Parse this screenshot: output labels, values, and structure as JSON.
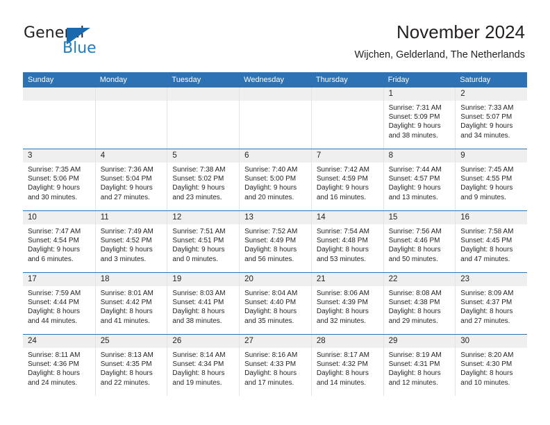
{
  "logo": {
    "word_general": "General",
    "word_blue": "Blue",
    "triangle_color": "#1b69ad",
    "blue_text_color": "#1f7dc1"
  },
  "header": {
    "title": "November 2024",
    "subtitle": "Wijchen, Gelderland, The Netherlands"
  },
  "theme": {
    "header_blue": "#2c72b4",
    "daynum_band": "#efefef",
    "grid_line": "#e3e3e3",
    "text": "#231f20"
  },
  "weekdays": [
    "Sunday",
    "Monday",
    "Tuesday",
    "Wednesday",
    "Thursday",
    "Friday",
    "Saturday"
  ],
  "weeks": [
    [
      {
        "day": "",
        "sunrise": "",
        "sunset": "",
        "daylight1": "",
        "daylight2": "",
        "empty": true
      },
      {
        "day": "",
        "sunrise": "",
        "sunset": "",
        "daylight1": "",
        "daylight2": "",
        "empty": true
      },
      {
        "day": "",
        "sunrise": "",
        "sunset": "",
        "daylight1": "",
        "daylight2": "",
        "empty": true
      },
      {
        "day": "",
        "sunrise": "",
        "sunset": "",
        "daylight1": "",
        "daylight2": "",
        "empty": true
      },
      {
        "day": "",
        "sunrise": "",
        "sunset": "",
        "daylight1": "",
        "daylight2": "",
        "empty": true
      },
      {
        "day": "1",
        "sunrise": "Sunrise: 7:31 AM",
        "sunset": "Sunset: 5:09 PM",
        "daylight1": "Daylight: 9 hours",
        "daylight2": "and 38 minutes.",
        "empty": false
      },
      {
        "day": "2",
        "sunrise": "Sunrise: 7:33 AM",
        "sunset": "Sunset: 5:07 PM",
        "daylight1": "Daylight: 9 hours",
        "daylight2": "and 34 minutes.",
        "empty": false
      }
    ],
    [
      {
        "day": "3",
        "sunrise": "Sunrise: 7:35 AM",
        "sunset": "Sunset: 5:06 PM",
        "daylight1": "Daylight: 9 hours",
        "daylight2": "and 30 minutes.",
        "empty": false
      },
      {
        "day": "4",
        "sunrise": "Sunrise: 7:36 AM",
        "sunset": "Sunset: 5:04 PM",
        "daylight1": "Daylight: 9 hours",
        "daylight2": "and 27 minutes.",
        "empty": false
      },
      {
        "day": "5",
        "sunrise": "Sunrise: 7:38 AM",
        "sunset": "Sunset: 5:02 PM",
        "daylight1": "Daylight: 9 hours",
        "daylight2": "and 23 minutes.",
        "empty": false
      },
      {
        "day": "6",
        "sunrise": "Sunrise: 7:40 AM",
        "sunset": "Sunset: 5:00 PM",
        "daylight1": "Daylight: 9 hours",
        "daylight2": "and 20 minutes.",
        "empty": false
      },
      {
        "day": "7",
        "sunrise": "Sunrise: 7:42 AM",
        "sunset": "Sunset: 4:59 PM",
        "daylight1": "Daylight: 9 hours",
        "daylight2": "and 16 minutes.",
        "empty": false
      },
      {
        "day": "8",
        "sunrise": "Sunrise: 7:44 AM",
        "sunset": "Sunset: 4:57 PM",
        "daylight1": "Daylight: 9 hours",
        "daylight2": "and 13 minutes.",
        "empty": false
      },
      {
        "day": "9",
        "sunrise": "Sunrise: 7:45 AM",
        "sunset": "Sunset: 4:55 PM",
        "daylight1": "Daylight: 9 hours",
        "daylight2": "and 9 minutes.",
        "empty": false
      }
    ],
    [
      {
        "day": "10",
        "sunrise": "Sunrise: 7:47 AM",
        "sunset": "Sunset: 4:54 PM",
        "daylight1": "Daylight: 9 hours",
        "daylight2": "and 6 minutes.",
        "empty": false
      },
      {
        "day": "11",
        "sunrise": "Sunrise: 7:49 AM",
        "sunset": "Sunset: 4:52 PM",
        "daylight1": "Daylight: 9 hours",
        "daylight2": "and 3 minutes.",
        "empty": false
      },
      {
        "day": "12",
        "sunrise": "Sunrise: 7:51 AM",
        "sunset": "Sunset: 4:51 PM",
        "daylight1": "Daylight: 9 hours",
        "daylight2": "and 0 minutes.",
        "empty": false
      },
      {
        "day": "13",
        "sunrise": "Sunrise: 7:52 AM",
        "sunset": "Sunset: 4:49 PM",
        "daylight1": "Daylight: 8 hours",
        "daylight2": "and 56 minutes.",
        "empty": false
      },
      {
        "day": "14",
        "sunrise": "Sunrise: 7:54 AM",
        "sunset": "Sunset: 4:48 PM",
        "daylight1": "Daylight: 8 hours",
        "daylight2": "and 53 minutes.",
        "empty": false
      },
      {
        "day": "15",
        "sunrise": "Sunrise: 7:56 AM",
        "sunset": "Sunset: 4:46 PM",
        "daylight1": "Daylight: 8 hours",
        "daylight2": "and 50 minutes.",
        "empty": false
      },
      {
        "day": "16",
        "sunrise": "Sunrise: 7:58 AM",
        "sunset": "Sunset: 4:45 PM",
        "daylight1": "Daylight: 8 hours",
        "daylight2": "and 47 minutes.",
        "empty": false
      }
    ],
    [
      {
        "day": "17",
        "sunrise": "Sunrise: 7:59 AM",
        "sunset": "Sunset: 4:44 PM",
        "daylight1": "Daylight: 8 hours",
        "daylight2": "and 44 minutes.",
        "empty": false
      },
      {
        "day": "18",
        "sunrise": "Sunrise: 8:01 AM",
        "sunset": "Sunset: 4:42 PM",
        "daylight1": "Daylight: 8 hours",
        "daylight2": "and 41 minutes.",
        "empty": false
      },
      {
        "day": "19",
        "sunrise": "Sunrise: 8:03 AM",
        "sunset": "Sunset: 4:41 PM",
        "daylight1": "Daylight: 8 hours",
        "daylight2": "and 38 minutes.",
        "empty": false
      },
      {
        "day": "20",
        "sunrise": "Sunrise: 8:04 AM",
        "sunset": "Sunset: 4:40 PM",
        "daylight1": "Daylight: 8 hours",
        "daylight2": "and 35 minutes.",
        "empty": false
      },
      {
        "day": "21",
        "sunrise": "Sunrise: 8:06 AM",
        "sunset": "Sunset: 4:39 PM",
        "daylight1": "Daylight: 8 hours",
        "daylight2": "and 32 minutes.",
        "empty": false
      },
      {
        "day": "22",
        "sunrise": "Sunrise: 8:08 AM",
        "sunset": "Sunset: 4:38 PM",
        "daylight1": "Daylight: 8 hours",
        "daylight2": "and 29 minutes.",
        "empty": false
      },
      {
        "day": "23",
        "sunrise": "Sunrise: 8:09 AM",
        "sunset": "Sunset: 4:37 PM",
        "daylight1": "Daylight: 8 hours",
        "daylight2": "and 27 minutes.",
        "empty": false
      }
    ],
    [
      {
        "day": "24",
        "sunrise": "Sunrise: 8:11 AM",
        "sunset": "Sunset: 4:36 PM",
        "daylight1": "Daylight: 8 hours",
        "daylight2": "and 24 minutes.",
        "empty": false
      },
      {
        "day": "25",
        "sunrise": "Sunrise: 8:13 AM",
        "sunset": "Sunset: 4:35 PM",
        "daylight1": "Daylight: 8 hours",
        "daylight2": "and 22 minutes.",
        "empty": false
      },
      {
        "day": "26",
        "sunrise": "Sunrise: 8:14 AM",
        "sunset": "Sunset: 4:34 PM",
        "daylight1": "Daylight: 8 hours",
        "daylight2": "and 19 minutes.",
        "empty": false
      },
      {
        "day": "27",
        "sunrise": "Sunrise: 8:16 AM",
        "sunset": "Sunset: 4:33 PM",
        "daylight1": "Daylight: 8 hours",
        "daylight2": "and 17 minutes.",
        "empty": false
      },
      {
        "day": "28",
        "sunrise": "Sunrise: 8:17 AM",
        "sunset": "Sunset: 4:32 PM",
        "daylight1": "Daylight: 8 hours",
        "daylight2": "and 14 minutes.",
        "empty": false
      },
      {
        "day": "29",
        "sunrise": "Sunrise: 8:19 AM",
        "sunset": "Sunset: 4:31 PM",
        "daylight1": "Daylight: 8 hours",
        "daylight2": "and 12 minutes.",
        "empty": false
      },
      {
        "day": "30",
        "sunrise": "Sunrise: 8:20 AM",
        "sunset": "Sunset: 4:30 PM",
        "daylight1": "Daylight: 8 hours",
        "daylight2": "and 10 minutes.",
        "empty": false
      }
    ]
  ]
}
